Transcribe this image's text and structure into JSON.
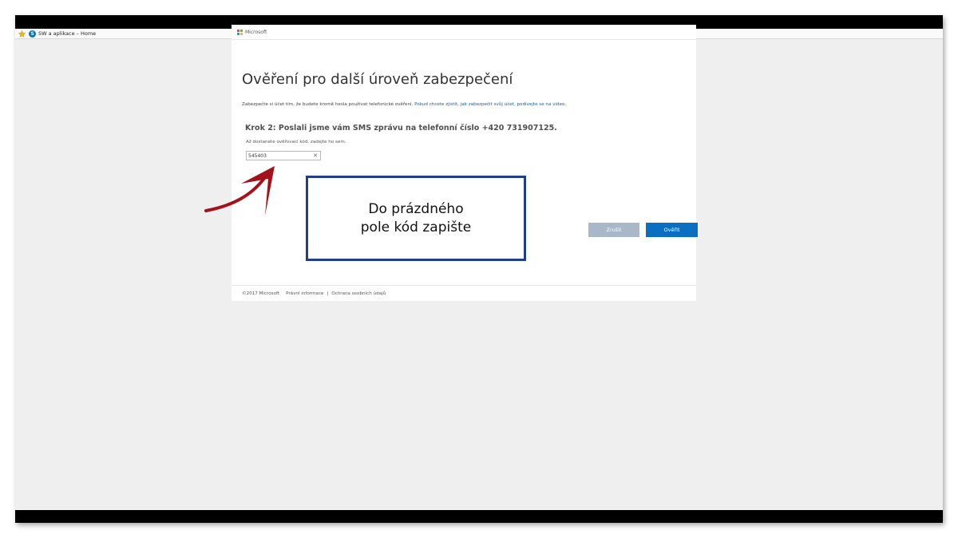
{
  "favorites_bar": {
    "item_label": "SW a aplikace – Home"
  },
  "header": {
    "brand": "Microsoft"
  },
  "main": {
    "title": "Ověření pro další úroveň zabezpečení",
    "intro_text": "Zabezpečte si účet tím, že budete kromě hesla používat telefonické ověření. ",
    "intro_link": "Pokud chcete zjistit, jak zabezpečit svůj účet, podívejte se na video.",
    "step_heading": "Krok 2: Poslali jsme vám SMS zprávu na telefonní číslo +420 731907125.",
    "hint": "Až dostanete ověřovací kód, zadejte ho sem.",
    "code_value": "545403",
    "cancel_label": "Zrušit",
    "verify_label": "Ověřit"
  },
  "footer": {
    "copyright": "©2017 Microsoft",
    "legal": "Právní informace",
    "separator": "|",
    "privacy": "Ochrana osobních údajů"
  },
  "annotation": {
    "line1": "Do prázdného",
    "line2": "pole kód zapište",
    "arrow_color": "#a3121b",
    "box_color": "#1f3f8a"
  },
  "colors": {
    "accent": "#0a6fc0",
    "button_disabled": "#a8b8c8",
    "link": "#0067b8"
  }
}
